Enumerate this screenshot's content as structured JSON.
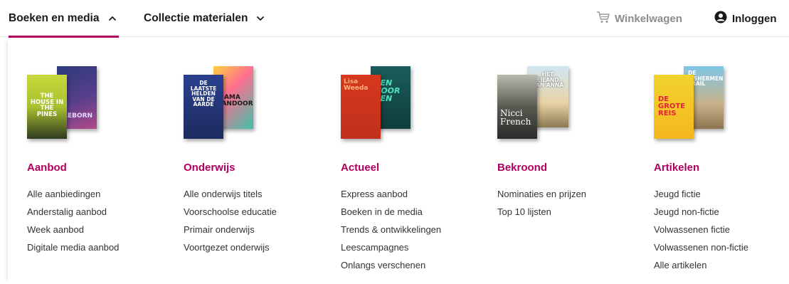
{
  "nav": {
    "tabs": [
      {
        "label": "Boeken en media",
        "expanded": true
      },
      {
        "label": "Collectie materialen",
        "expanded": false
      }
    ],
    "cart_label": "Winkelwagen",
    "login_label": "Inloggen"
  },
  "colors": {
    "accent": "#b0005f",
    "text": "#333333",
    "muted": "#8c8c8c"
  },
  "columns": [
    {
      "title": "Aanbod",
      "links": [
        "Alle aanbiedingen",
        "Anderstalig aanbod",
        "Week aanbod",
        "Digitale media aanbod"
      ],
      "cover_texts": [
        "THE HOUSE IN THE PINES",
        "REBORN"
      ]
    },
    {
      "title": "Onderwijs",
      "links": [
        "Alle onderwijs titels",
        "Voorschoolse educatie",
        "Primair onderwijs",
        "Voortgezet onderwijs"
      ],
      "cover_texts": [
        "DE LAATSTE HELDEN VAN DE AARDE",
        "MAMA TANDOORI"
      ]
    },
    {
      "title": "Actueel",
      "links": [
        "Express aanbod",
        "Boeken in de media",
        "Trends & ontwikkelingen",
        "Leescampagnes",
        "Onlangs verschenen"
      ],
      "cover_texts": [
        "Lisa Weeda",
        "EEN VOOR EEN"
      ]
    },
    {
      "title": "Bekroond",
      "links": [
        "Nominaties en prijzen",
        "Top 10 lijsten"
      ],
      "cover_texts": [
        "Nicci French",
        "HET EILAND VAN ANNA"
      ]
    },
    {
      "title": "Artikelen",
      "links": [
        "Jeugd fictie",
        "Jeugd non-fictie",
        "Volwassenen fictie",
        "Volwassenen non-fictie",
        "Alle artikelen"
      ],
      "cover_texts": [
        "DE GROTE REIS",
        "DE FISHERMEN'S TRAIL"
      ]
    }
  ]
}
